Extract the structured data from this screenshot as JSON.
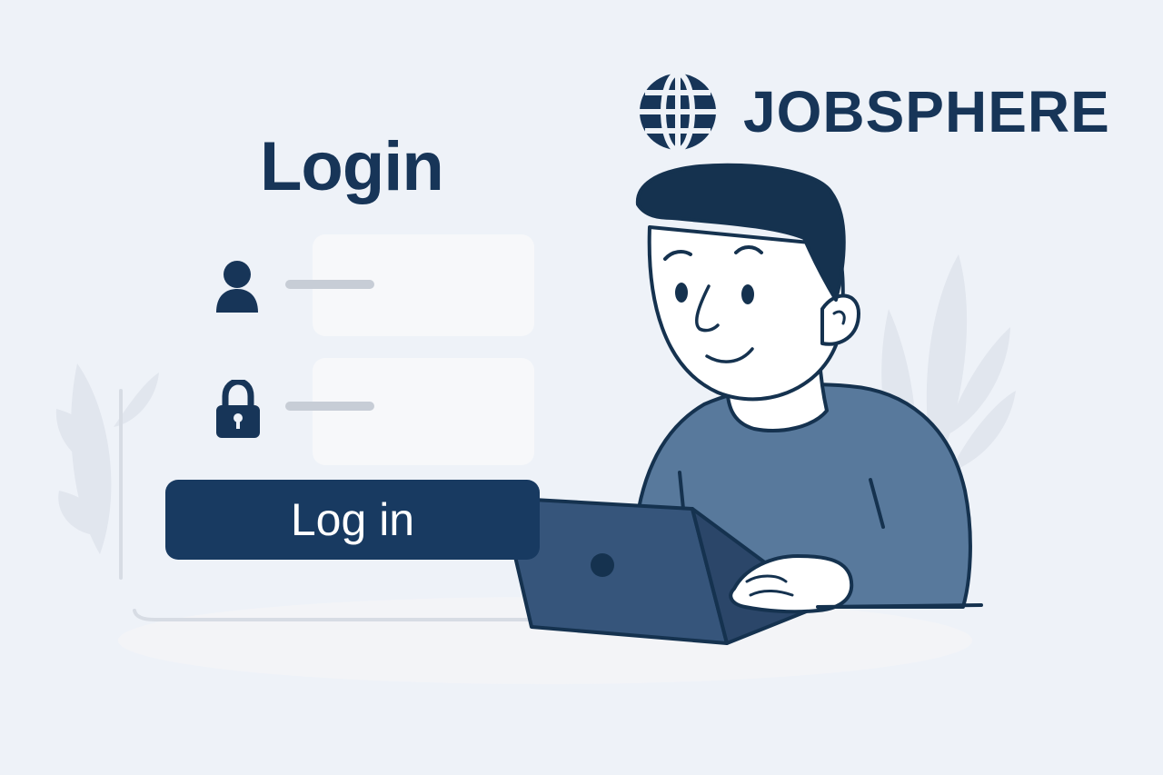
{
  "brand": {
    "name": "JOBSPHERE",
    "icon": "globe-icon",
    "color": "#173558"
  },
  "login": {
    "title": "Login",
    "username_icon": "user-icon",
    "password_icon": "lock-icon",
    "button_label": "Log in"
  },
  "colors": {
    "background": "#eef2f8",
    "navy": "#183a61",
    "shirt": "#58799c",
    "laptop": "#36557b",
    "field": "#f7f8fa",
    "placeholder_line": "#c7cdd6"
  }
}
